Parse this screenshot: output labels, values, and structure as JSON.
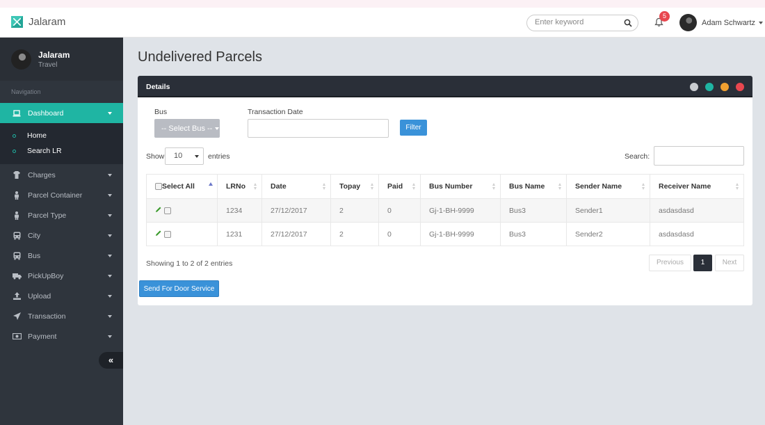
{
  "app": {
    "name": "Jalaram"
  },
  "header": {
    "search_placeholder": "Enter keyword",
    "notification_count": "5",
    "user_name": "Adam Schwartz"
  },
  "sidebar": {
    "profile_name": "Jalaram",
    "profile_sub": "Travel",
    "nav_title": "Navigation",
    "items": [
      {
        "label": "Dashboard",
        "icon": "laptop-icon"
      },
      {
        "label": "Charges",
        "icon": "tshirt-icon"
      },
      {
        "label": "Parcel Container",
        "icon": "user-icon"
      },
      {
        "label": "Parcel Type",
        "icon": "user-icon"
      },
      {
        "label": "City",
        "icon": "bus-icon"
      },
      {
        "label": "Bus",
        "icon": "bus-icon"
      },
      {
        "label": "PickUpBoy",
        "icon": "truck-icon"
      },
      {
        "label": "Upload",
        "icon": "upload-icon"
      },
      {
        "label": "Transaction",
        "icon": "send-icon"
      },
      {
        "label": "Payment",
        "icon": "money-icon"
      }
    ],
    "submenu": [
      {
        "label": "Home"
      },
      {
        "label": "Search LR"
      }
    ],
    "collapse_label": "«"
  },
  "page": {
    "title": "Undelivered Parcels"
  },
  "panel": {
    "title": "Details",
    "bus_label": "Bus",
    "bus_select": "-- Select Bus --",
    "date_label": "Transaction Date",
    "filter_label": "Filter",
    "show_label": "Show",
    "show_value": "10",
    "entries_label": "entries",
    "search_label": "Search:",
    "columns": [
      "Select All",
      "LRNo",
      "Date",
      "Topay",
      "Paid",
      "Bus Number",
      "Bus Name",
      "Sender Name",
      "Receiver Name"
    ],
    "rows": [
      {
        "lrno": "1234",
        "date": "27/12/2017",
        "topay": "2",
        "paid": "0",
        "bus_number": "Gj-1-BH-9999",
        "bus_name": "Bus3",
        "sender": "Sender1",
        "receiver": "asdasdasd"
      },
      {
        "lrno": "1231",
        "date": "27/12/2017",
        "topay": "2",
        "paid": "0",
        "bus_number": "Gj-1-BH-9999",
        "bus_name": "Bus3",
        "sender": "Sender2",
        "receiver": "asdasdasd"
      }
    ],
    "showing_text": "Showing 1 to 2 of 2 entries",
    "prev_label": "Previous",
    "page_label": "1",
    "next_label": "Next",
    "door_service_label": "Send For Door Service"
  },
  "colors": {
    "accent": "#1fb5a3",
    "primary_button": "#3a92d9",
    "sidebar_bg": "#2f353d",
    "badge": "#e8474f"
  }
}
